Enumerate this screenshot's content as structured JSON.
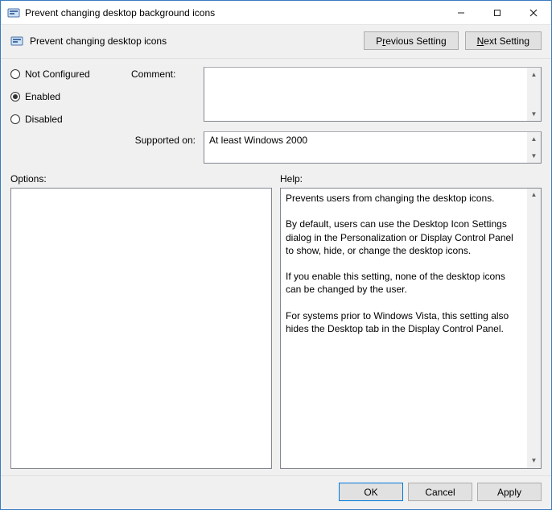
{
  "window": {
    "title": "Prevent changing desktop background icons"
  },
  "header": {
    "title": "Prevent changing desktop icons",
    "prev_pre": "P",
    "prev_u": "r",
    "prev_post": "evious Setting",
    "next_pre": "",
    "next_u": "N",
    "next_post": "ext Setting"
  },
  "state": {
    "not_configured": "Not Configured",
    "enabled": "Enabled",
    "disabled": "Disabled",
    "comment_label": "Comment:",
    "comment_value": "",
    "supported_label": "Supported on:",
    "supported_value": "At least Windows 2000"
  },
  "lower": {
    "options_label": "Options:",
    "help_label": "Help:",
    "help_p1": "Prevents users from changing the desktop icons.",
    "help_p2": "By default, users can use the Desktop Icon Settings dialog in the Personalization or Display Control Panel to show, hide, or change the desktop icons.",
    "help_p3": "If you enable this setting, none of the desktop icons can be changed by the user.",
    "help_p4": "For systems prior to Windows Vista, this setting also hides the Desktop tab in the Display Control Panel."
  },
  "footer": {
    "ok": "OK",
    "cancel": "Cancel",
    "apply": "Apply"
  }
}
